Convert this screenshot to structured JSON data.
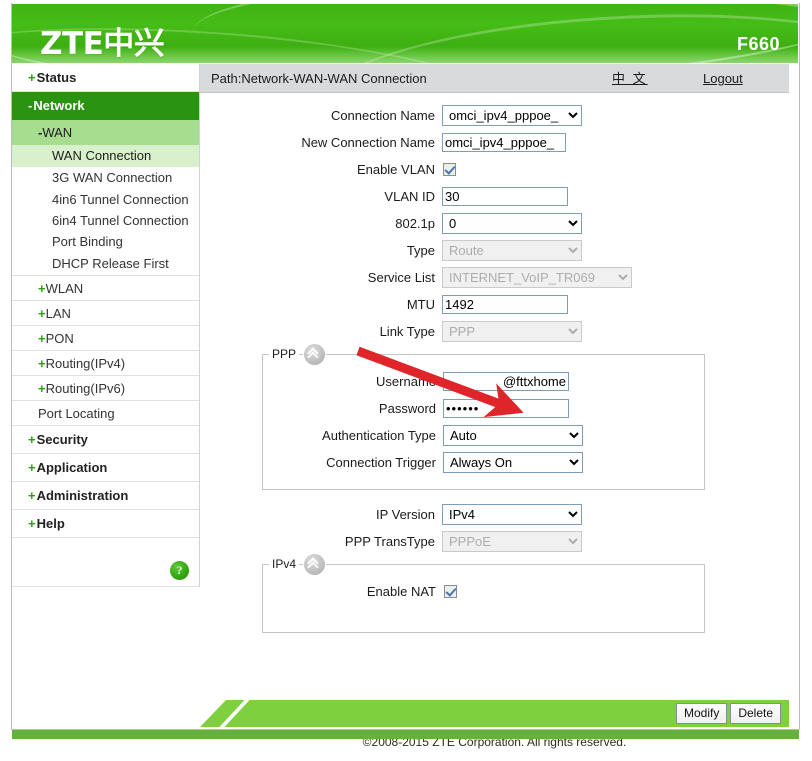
{
  "header": {
    "logo_text": "ZTE中兴",
    "model": "F660"
  },
  "pathbar": {
    "path": "Path:Network-WAN-WAN Connection",
    "language_link": "中 文",
    "logout_link": "Logout"
  },
  "sidebar": {
    "items": [
      {
        "label": "Status",
        "prefix": "+",
        "level": 1
      },
      {
        "label": "Network",
        "prefix": "-",
        "level": 1,
        "state": "active"
      },
      {
        "label": "WAN",
        "prefix": "-",
        "level": 2,
        "state": "open"
      },
      {
        "label": "WAN Connection",
        "level": 3,
        "state": "selected"
      },
      {
        "label": "3G WAN Connection",
        "level": 3
      },
      {
        "label": "4in6 Tunnel Connection",
        "level": 3
      },
      {
        "label": "6in4 Tunnel Connection",
        "level": 3
      },
      {
        "label": "Port Binding",
        "level": 3
      },
      {
        "label": "DHCP Release First",
        "level": 3
      },
      {
        "label": "WLAN",
        "prefix": "+",
        "level": 2
      },
      {
        "label": "LAN",
        "prefix": "+",
        "level": 2
      },
      {
        "label": "PON",
        "prefix": "+",
        "level": 2
      },
      {
        "label": "Routing(IPv4)",
        "prefix": "+",
        "level": 2
      },
      {
        "label": "Routing(IPv6)",
        "prefix": "+",
        "level": 2
      },
      {
        "label": "Port Locating",
        "level": 2
      },
      {
        "label": "Security",
        "prefix": "+",
        "level": 1
      },
      {
        "label": "Application",
        "prefix": "+",
        "level": 1
      },
      {
        "label": "Administration",
        "prefix": "+",
        "level": 1
      },
      {
        "label": "Help",
        "prefix": "+",
        "level": 1
      }
    ],
    "help_icon": "?"
  },
  "form": {
    "connection_name": {
      "label": "Connection Name",
      "value": "omci_ipv4_pppoe_",
      "type": "select",
      "disabled": false
    },
    "new_connection_name": {
      "label": "New Connection Name",
      "value": "omci_ipv4_pppoe_",
      "type": "text",
      "disabled": false
    },
    "enable_vlan": {
      "label": "Enable VLAN",
      "checked": true,
      "type": "checkbox"
    },
    "vlan_id": {
      "label": "VLAN ID",
      "value": "30",
      "type": "text"
    },
    "dot1p": {
      "label": "802.1p",
      "value": "0",
      "type": "select"
    },
    "type": {
      "label": "Type",
      "value": "Route",
      "type": "select",
      "disabled": true
    },
    "service_list": {
      "label": "Service List",
      "value": "INTERNET_VoIP_TR069",
      "type": "select",
      "disabled": true
    },
    "mtu": {
      "label": "MTU",
      "value": "1492",
      "type": "text"
    },
    "link_type": {
      "label": "Link Type",
      "value": "PPP",
      "type": "select",
      "disabled": true
    },
    "ip_version": {
      "label": "IP Version",
      "value": "IPv4",
      "type": "select",
      "disabled": false
    },
    "ppp_transtype": {
      "label": "PPP TransType",
      "value": "PPPoE",
      "type": "select",
      "disabled": true
    }
  },
  "ppp_group": {
    "title": "PPP",
    "username": {
      "label": "Username",
      "value": "@fttxhome",
      "type": "text"
    },
    "password": {
      "label": "Password",
      "value": "••••••",
      "type": "password"
    },
    "auth_type": {
      "label": "Authentication Type",
      "value": "Auto",
      "type": "select"
    },
    "connection_trigger": {
      "label": "Connection Trigger",
      "value": "Always On",
      "type": "select"
    }
  },
  "ipv4_group": {
    "title": "IPv4",
    "enable_nat": {
      "label": "Enable NAT",
      "checked": true,
      "type": "checkbox"
    }
  },
  "footer": {
    "modify_label": "Modify",
    "delete_label": "Delete",
    "copyright": "©2008-2015 ZTE Corporation. All rights reserved."
  },
  "annotation": {
    "type": "red-arrow",
    "color": "#e0252a",
    "points_to": "Username"
  },
  "colors": {
    "brand_green": "#45bd16",
    "nav_active": "#2a9412",
    "nav_open": "#a6dd8f",
    "nav_selected": "#d9f0cd",
    "footer_band": "#7ed03f",
    "bottom_bar": "#62b338",
    "pathbar_bg": "#d9dadc",
    "annotation_red": "#e0252a"
  }
}
